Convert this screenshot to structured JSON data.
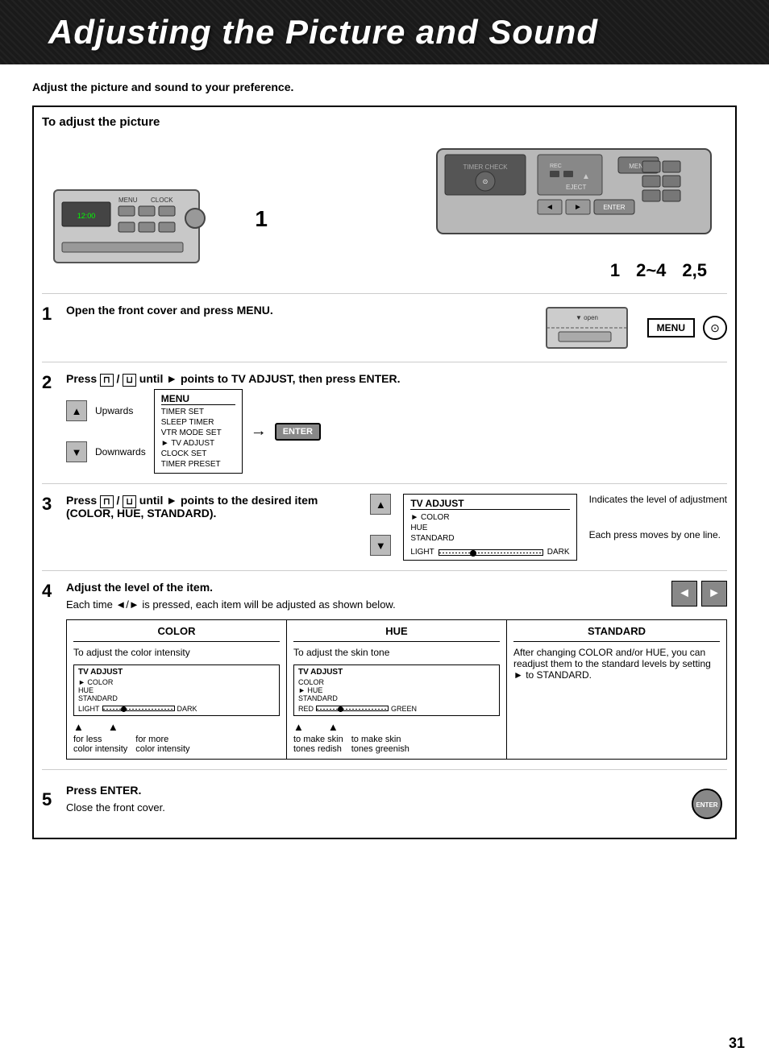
{
  "header": {
    "title": "Adjusting the Picture and Sound"
  },
  "intro": {
    "text": "Adjust the picture and sound to your preference."
  },
  "box_title": "To adjust the picture",
  "devices": {
    "step1_label": "1",
    "remote_label": "1",
    "numbers": "2~4   2,5"
  },
  "steps": [
    {
      "number": "1",
      "title": "Open the front cover and press MENU.",
      "button_label": "MENU"
    },
    {
      "number": "2",
      "title": "Press  /  until ► points to TV ADJUST, then press ENTER.",
      "up_label": "Upwards",
      "down_label": "Downwards",
      "menu": {
        "title": "MENU",
        "items": [
          "TIMER SET",
          "SLEEP TIMER",
          "VTR MODE SET",
          "► TV ADJUST",
          "CLOCK SET",
          "TIMER PRESET"
        ]
      },
      "enter_label": "ENTER"
    },
    {
      "number": "3",
      "title": "Press  /  until ► points to the desired item (COLOR, HUE, STANDARD).",
      "tv_adjust": {
        "title": "TV ADJUST",
        "items": [
          "► COLOR",
          "HUE",
          "STANDARD"
        ]
      },
      "indicates_label": "Indicates the level of adjustment",
      "each_press_label": "Each press moves by one line."
    },
    {
      "number": "4",
      "title": "Adjust the level of the item.",
      "subtitle": "Each time ◄/► is pressed, each item will be adjusted as shown below.",
      "color": {
        "header": "COLOR",
        "desc": "To adjust the color intensity",
        "tv_adjust": {
          "title": "TV ADJUST",
          "items": [
            "► COLOR",
            "HUE",
            "STANDARD"
          ]
        },
        "slider_left": "LIGHT",
        "slider_right": "DARK",
        "footer_left": "for less color intensity",
        "footer_right": "for more color intensity"
      },
      "hue": {
        "header": "HUE",
        "desc": "To adjust the skin tone",
        "tv_adjust": {
          "title": "TV ADJUST",
          "items": [
            "COLOR",
            "► HUE",
            "STANDARD"
          ]
        },
        "slider_left": "RED",
        "slider_right": "GREEN",
        "footer_left": "to make skin tones redish",
        "footer_right": "to make skin tones greenish"
      },
      "standard": {
        "header": "STANDARD",
        "desc": "After changing COLOR and/or HUE, you can readjust them to the standard levels by setting ► to STANDARD."
      }
    },
    {
      "number": "5",
      "title": "Press ENTER.",
      "subtitle": "Close the front cover.",
      "enter_label": "ENTER"
    }
  ],
  "page_number": "31"
}
